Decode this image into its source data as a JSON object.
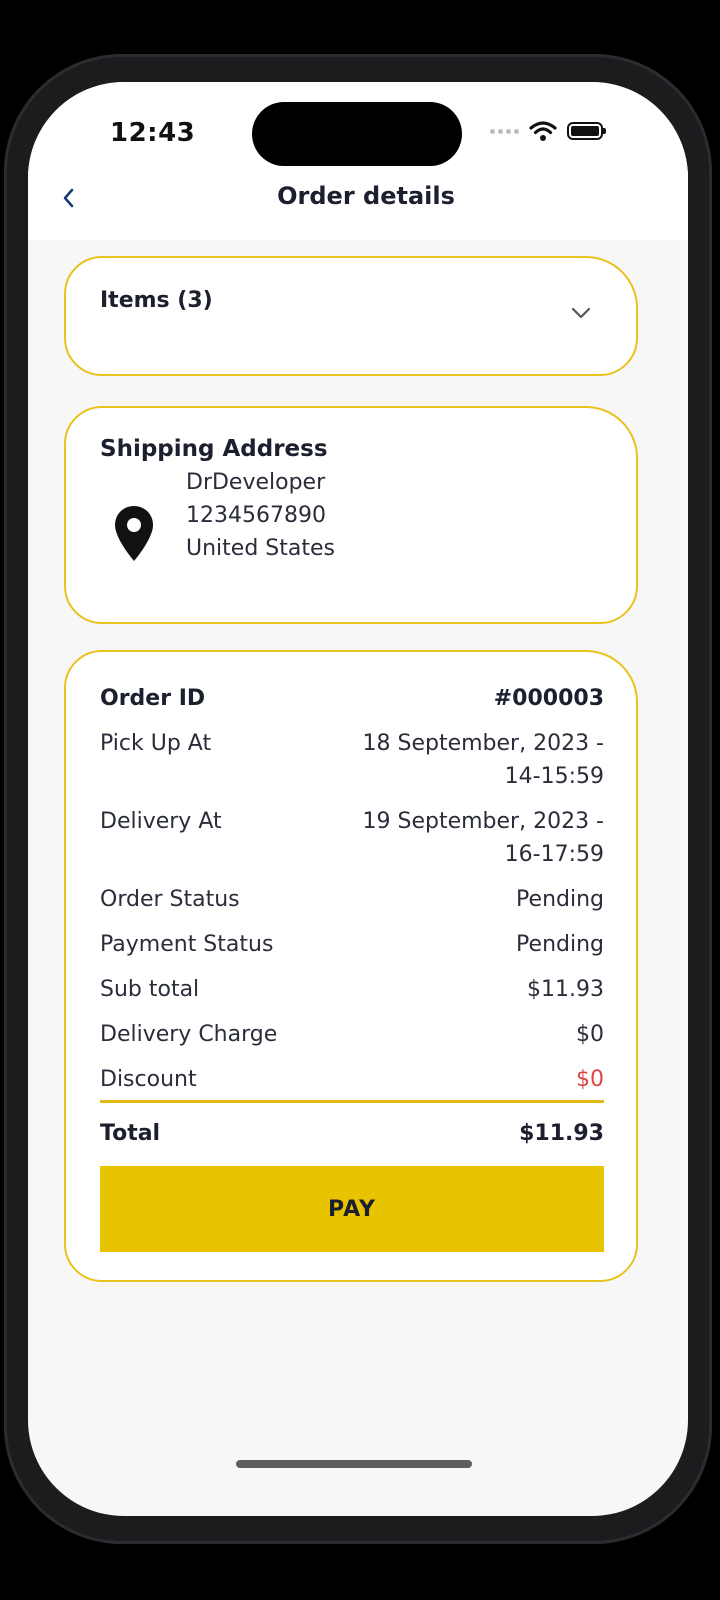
{
  "status_bar": {
    "time": "12:43",
    "icons": [
      "cellular-dots-icon",
      "wifi-icon",
      "battery-icon"
    ]
  },
  "header": {
    "back_icon": "chevron-left-icon",
    "title": "Order details"
  },
  "items_card": {
    "label": "Items (3)",
    "expand_icon": "chevron-down-icon"
  },
  "shipping": {
    "title": "Shipping Address",
    "icon": "location-pin-icon",
    "name": "DrDeveloper",
    "phone": "1234567890",
    "country": "United States"
  },
  "order": {
    "rows": [
      {
        "label": "Order ID",
        "value": "#000003"
      },
      {
        "label": "Pick Up At",
        "value": "18 September, 2023 - 14-15:59"
      },
      {
        "label": "Delivery At",
        "value": "19 September, 2023 - 16-17:59"
      },
      {
        "label": "Order Status",
        "value": "Pending"
      },
      {
        "label": "Payment Status",
        "value": "Pending"
      },
      {
        "label": "Sub total",
        "value": "$11.93"
      },
      {
        "label": "Delivery Charge",
        "value": "$0"
      },
      {
        "label": "Discount",
        "value": "$0"
      }
    ],
    "total_label": "Total",
    "total_value": "$11.93",
    "pay_label": "PAY"
  },
  "colors": {
    "accent": "#e8c300",
    "card_border": "#e9c21d",
    "discount": "#e04545",
    "text": "#1c1f2e"
  }
}
